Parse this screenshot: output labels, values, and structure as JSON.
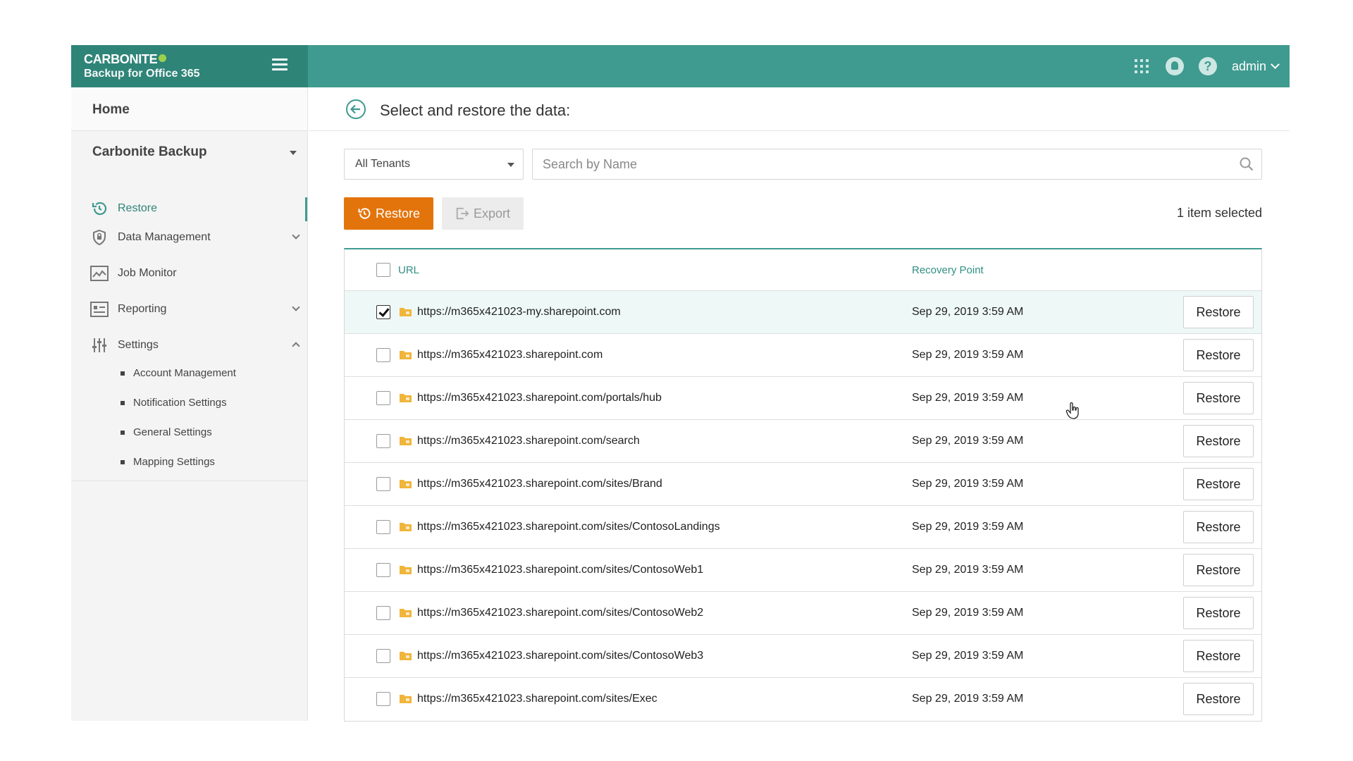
{
  "brand": {
    "name": "CARBONITE",
    "subtitle": "Backup for Office 365"
  },
  "topbar": {
    "user": "admin"
  },
  "sidebar": {
    "home": "Home",
    "section": "Carbonite Backup",
    "items": [
      {
        "label": "Restore",
        "icon": "restore-icon",
        "active": true
      },
      {
        "label": "Data Management",
        "icon": "shield-lock-icon"
      },
      {
        "label": "Job Monitor",
        "icon": "chart-icon"
      },
      {
        "label": "Reporting",
        "icon": "report-icon"
      },
      {
        "label": "Settings",
        "icon": "sliders-icon"
      }
    ],
    "settings_sub": [
      "Account Management",
      "Notification Settings",
      "General Settings",
      "Mapping Settings"
    ]
  },
  "main": {
    "title": "Select and restore the data:",
    "tenant_filter": "All Tenants",
    "search_placeholder": "Search by Name",
    "restore_label": "Restore",
    "export_label": "Export",
    "selected_count": "1 item selected",
    "columns": {
      "url": "URL",
      "recovery_point": "Recovery Point"
    },
    "row_action": "Restore",
    "rows": [
      {
        "url": "https://m365x421023-my.sharepoint.com",
        "date": "Sep 29, 2019 3:59 AM",
        "checked": true
      },
      {
        "url": "https://m365x421023.sharepoint.com",
        "date": "Sep 29, 2019 3:59 AM"
      },
      {
        "url": "https://m365x421023.sharepoint.com/portals/hub",
        "date": "Sep 29, 2019 3:59 AM"
      },
      {
        "url": "https://m365x421023.sharepoint.com/search",
        "date": "Sep 29, 2019 3:59 AM"
      },
      {
        "url": "https://m365x421023.sharepoint.com/sites/Brand",
        "date": "Sep 29, 2019 3:59 AM"
      },
      {
        "url": "https://m365x421023.sharepoint.com/sites/ContosoLandings",
        "date": "Sep 29, 2019 3:59 AM"
      },
      {
        "url": "https://m365x421023.sharepoint.com/sites/ContosoWeb1",
        "date": "Sep 29, 2019 3:59 AM"
      },
      {
        "url": "https://m365x421023.sharepoint.com/sites/ContosoWeb2",
        "date": "Sep 29, 2019 3:59 AM"
      },
      {
        "url": "https://m365x421023.sharepoint.com/sites/ContosoWeb3",
        "date": "Sep 29, 2019 3:59 AM"
      },
      {
        "url": "https://m365x421023.sharepoint.com/sites/Exec",
        "date": "Sep 29, 2019 3:59 AM"
      }
    ]
  },
  "colors": {
    "brand_teal": "#3f9a8f",
    "brand_dark": "#2f8478",
    "action_orange": "#e3740c",
    "folder": "#f0b53a"
  }
}
